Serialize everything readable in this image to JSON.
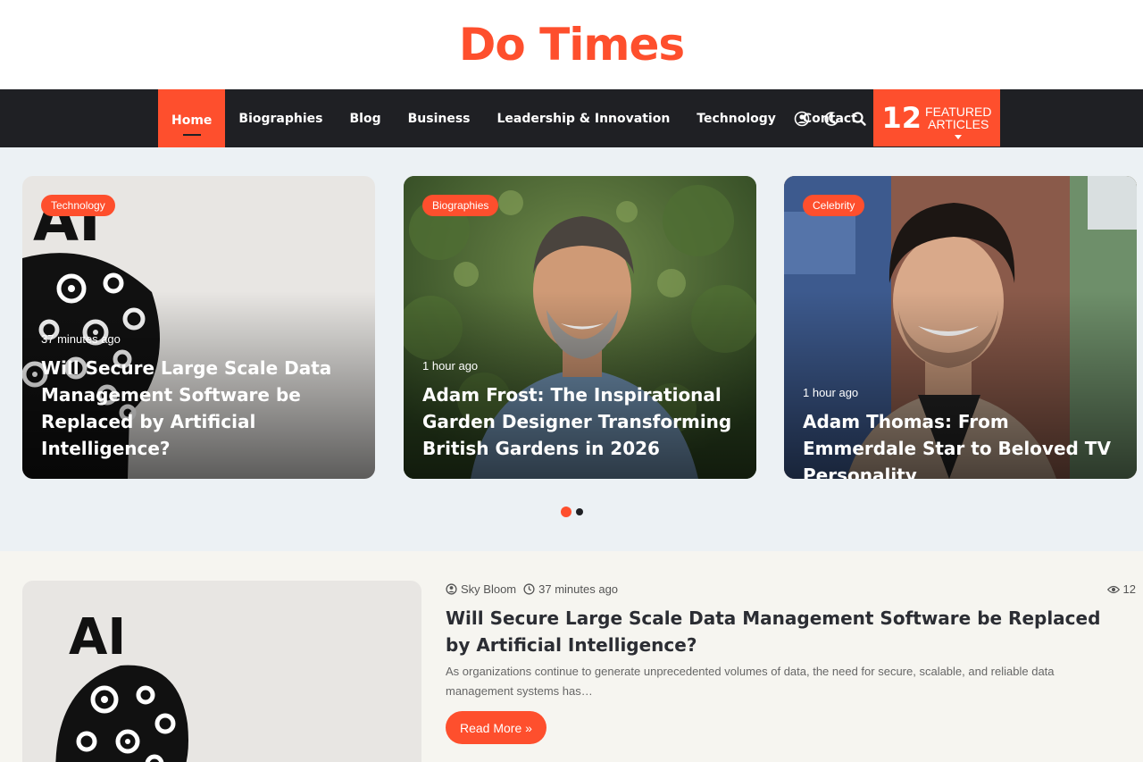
{
  "colors": {
    "accent": "#fe4f2d",
    "nav_bg": "#1f2024",
    "celebrity_badge": "#fe4f2d"
  },
  "site": {
    "logo": "Do Times"
  },
  "nav": {
    "items": [
      {
        "label": "Home",
        "active": true
      },
      {
        "label": "Biographies"
      },
      {
        "label": "Blog"
      },
      {
        "label": "Business"
      },
      {
        "label": "Leadership & Innovation"
      },
      {
        "label": "Technology"
      },
      {
        "label": "Contact"
      }
    ],
    "icons": [
      "user-icon",
      "moon-icon",
      "search-icon"
    ],
    "featured": {
      "count": "12",
      "line1": "Featured",
      "line2": "Articles"
    }
  },
  "slider": {
    "cards": [
      {
        "category": "Technology",
        "time": "37 minutes ago",
        "title": "Will Secure Large Scale Data Management Software be Replaced by Artificial Intelligence?"
      },
      {
        "category": "Biographies",
        "time": "1 hour ago",
        "title": "Adam Frost: The Inspirational Garden Designer Transforming British Gardens in 2026"
      },
      {
        "category": "Celebrity",
        "time": "1 hour ago",
        "title": "Adam Thomas: From Emmerdale Star to Beloved TV Personality"
      }
    ],
    "pages": 2,
    "active_page": 1
  },
  "article": {
    "author": "Sky Bloom",
    "time": "37 minutes ago",
    "views": "12",
    "title": "Will Secure Large Scale Data Management Software be Replaced by Artificial Intelligence?",
    "excerpt": "As organizations continue to generate unprecedented volumes of data, the need for secure, scalable, and reliable data management systems has…",
    "read_more": "Read More »"
  },
  "ai_art_text": "AI"
}
